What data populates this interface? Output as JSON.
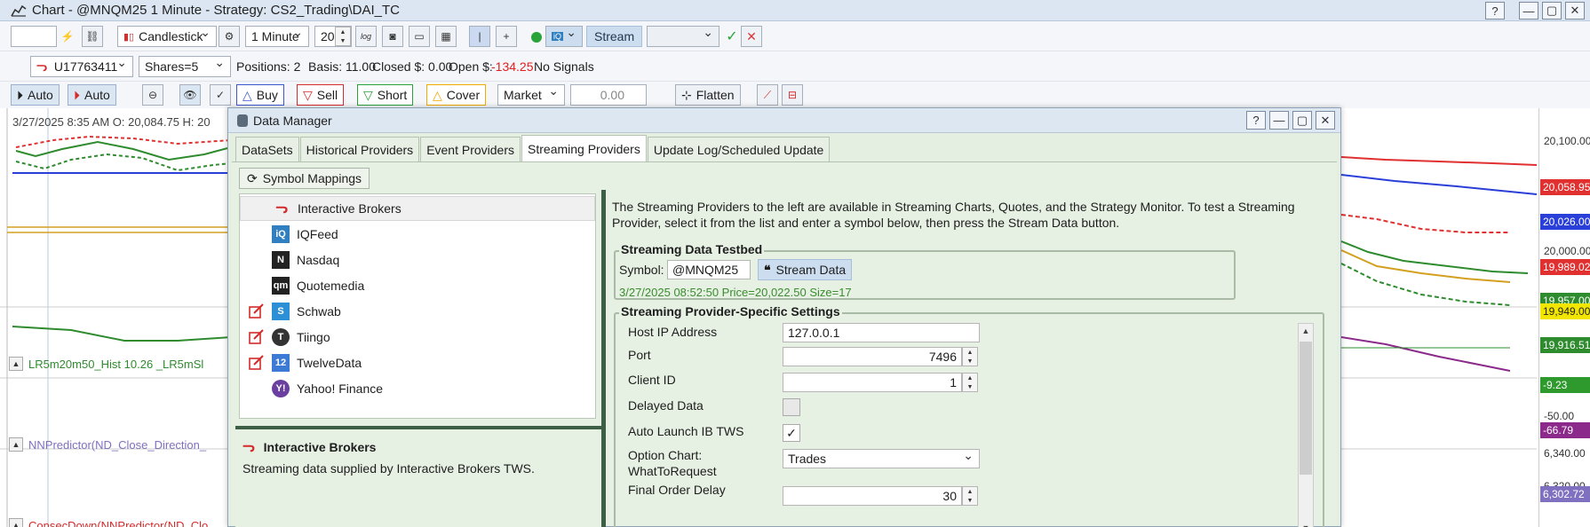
{
  "window": {
    "title": "Chart - @MNQM25 1 Minute - Strategy: CS2_Trading\\DAI_TC",
    "help": "?",
    "minimize": "—",
    "maximize": "▢",
    "close": "✕"
  },
  "toolbar1": {
    "symbol_value": "",
    "chart_type": "Candlestick",
    "interval": "1 Minute",
    "bars_value": "20",
    "log_label": "log",
    "stream_label": "Stream",
    "stream_combo": ""
  },
  "toolbar2": {
    "account": "U17763411",
    "shares": "Shares=5",
    "positions": "Positions: 2",
    "basis": "Basis: 11.00",
    "closed": "Closed $: 0.00",
    "open_label": "Open $:",
    "open_value": "-134.25",
    "signals": "No Signals"
  },
  "toolbar3": {
    "auto1": "Auto",
    "auto2": "Auto",
    "buy": "Buy",
    "sell": "Sell",
    "short": "Short",
    "cover": "Cover",
    "order_type": "Market",
    "price_value": "0.00",
    "flatten": "Flatten"
  },
  "chart": {
    "info": "3/27/2025 8:35 AM O: 20,084.75  H: 20",
    "price_labels": [
      "20,100.00",
      "20,000.00",
      "-50.00",
      "6,340.00",
      "6,320.00"
    ],
    "price_tags": [
      {
        "text": "20,058.95",
        "color": "#e03030"
      },
      {
        "text": "20,026.00",
        "color": "#2a3fd8"
      },
      {
        "text": "19,989.02",
        "color": "#e03030"
      },
      {
        "text": "19,957.00",
        "color": "#2e8b2e"
      },
      {
        "text": "19,949.00",
        "color": "#f2e600"
      },
      {
        "text": "19,916.51",
        "color": "#2e8b2e"
      },
      {
        "text": "-9.23",
        "color": "#2e9a2e"
      },
      {
        "text": "-66.79",
        "color": "#8b2a8b"
      },
      {
        "text": "6,302.72",
        "color": "#8070c0"
      }
    ],
    "panel1": "LR5m20m50_Hist 10.26 _LR5mSl",
    "panel2": "NNPredictor(ND_Close_Direction_",
    "panel3": "ConsecDown(NNPredictor(ND_Clo"
  },
  "dialog": {
    "title": "Data Manager",
    "help": "?",
    "tabs": [
      "DataSets",
      "Historical Providers",
      "Event Providers",
      "Streaming Providers",
      "Update Log/Scheduled Update"
    ],
    "symbol_mappings": "Symbol Mappings",
    "providers": [
      {
        "name": "Interactive Brokers",
        "icon": "ib-logo-icon",
        "logo_text": "",
        "logo_color": "#d42b2b",
        "editable": false,
        "selected": true
      },
      {
        "name": "IQFeed",
        "icon": "iqfeed-logo-icon",
        "logo_text": "iQ",
        "logo_color": "#2f7fc1",
        "editable": false,
        "selected": false
      },
      {
        "name": "Nasdaq",
        "icon": "nasdaq-logo-icon",
        "logo_text": "N",
        "logo_color": "#222222",
        "editable": false,
        "selected": false
      },
      {
        "name": "Quotemedia",
        "icon": "quotemedia-logo-icon",
        "logo_text": "qm",
        "logo_color": "#222222",
        "editable": false,
        "selected": false
      },
      {
        "name": "Schwab",
        "icon": "schwab-logo-icon",
        "logo_text": "S",
        "logo_color": "#2d8fd5",
        "editable": true,
        "selected": false
      },
      {
        "name": "Tiingo",
        "icon": "tiingo-logo-icon",
        "logo_text": "T",
        "logo_color": "#333333",
        "editable": true,
        "selected": false
      },
      {
        "name": "TwelveData",
        "icon": "twelvedata-logo-icon",
        "logo_text": "12",
        "logo_color": "#3c7ad6",
        "editable": true,
        "selected": false
      },
      {
        "name": "Yahoo! Finance",
        "icon": "yahoo-logo-icon",
        "logo_text": "Y!",
        "logo_color": "#6b3fa0",
        "editable": false,
        "selected": false
      }
    ],
    "description_title": "Interactive Brokers",
    "description_text": "Streaming data supplied by Interactive Brokers TWS.",
    "intro": "The Streaming Providers to the left are available in Streaming Charts, Quotes, and the Strategy Monitor. To test a Streaming Provider, select it from the list and enter a symbol below, then press the Stream Data button.",
    "testbed": {
      "title": "Streaming Data Testbed",
      "symbol_label": "Symbol:",
      "symbol_value": "@MNQM25",
      "stream_button": "Stream Data",
      "status": "3/27/2025 08:52:50 Price=20,022.50 Size=17"
    },
    "settings": {
      "title": "Streaming Provider-Specific Settings",
      "host_label": "Host IP Address",
      "host_value": "127.0.0.1",
      "port_label": "Port",
      "port_value": "7496",
      "client_label": "Client ID",
      "client_value": "1",
      "delayed_label": "Delayed Data",
      "autolaunch_label": "Auto Launch IB TWS",
      "option_label_1": "Option Chart:",
      "option_label_2": "WhatToRequest",
      "option_value": "Trades",
      "delay_label": "Final Order Delay",
      "delay_value": "30"
    }
  }
}
